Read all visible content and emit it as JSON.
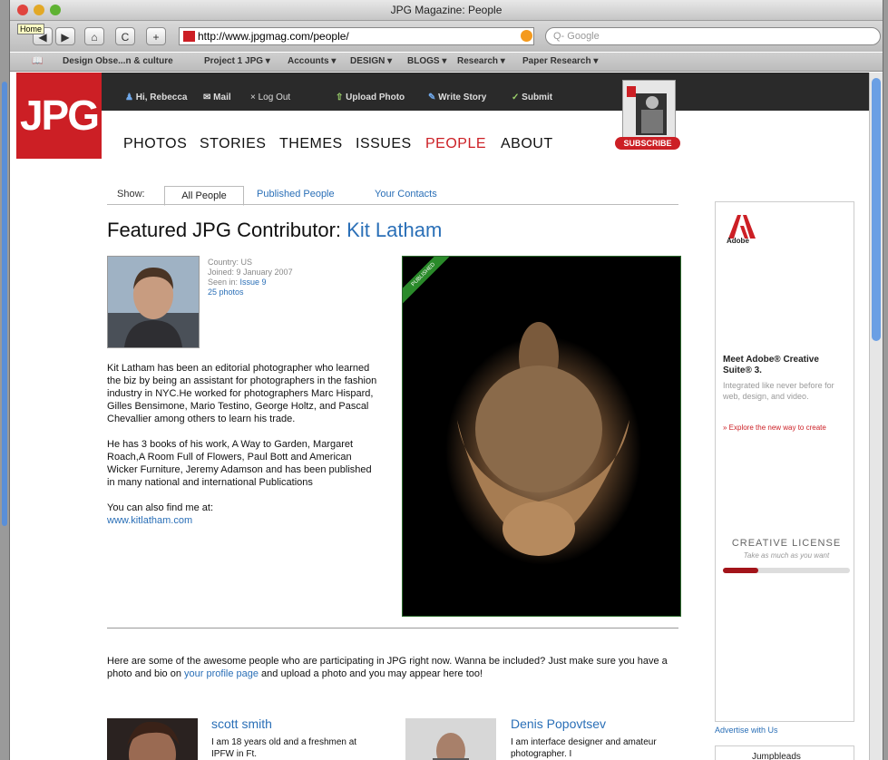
{
  "window": {
    "title": "JPG Magazine: People",
    "home_tooltip": "Home"
  },
  "toolbar": {
    "back": "◀",
    "forward": "▶",
    "home": "⌂",
    "reload": "C",
    "add": "+",
    "url": "http://www.jpgmag.com/people/",
    "search_placeholder": "Q- Google"
  },
  "bookmarks": [
    "Design Obse...n & culture",
    "Project 1 JPG ▾",
    "Accounts ▾",
    "DESIGN ▾",
    "BLOGS ▾",
    "Research ▾",
    "Paper Research ▾"
  ],
  "site": {
    "logo": "JPG",
    "user": {
      "greeting": "Hi, Rebecca",
      "mail": "Mail",
      "logout": "Log Out"
    },
    "actions": {
      "upload": "Upload Photo",
      "write": "Write Story",
      "submit": "Submit"
    },
    "nav": [
      "PHOTOS",
      "STORIES",
      "THEMES",
      "ISSUES",
      "PEOPLE",
      "ABOUT"
    ],
    "subscribe": "SUBSCRIBE",
    "accent": "#cc1f25"
  },
  "filter": {
    "show_label": "Show:",
    "tabs": [
      "All People",
      "Published People",
      "Your Contacts"
    ]
  },
  "featured": {
    "heading": "Featured JPG Contributor:",
    "name": "Kit Latham",
    "country": "Country: US",
    "joined": "Joined: 9 January 2007",
    "seen_in_label": "Seen in:",
    "seen_in_link": "Issue 9",
    "photos": "25 photos",
    "photo_ribbon": "PUBLISHED",
    "bio": [
      "Kit Latham has been an editorial photographer who learned the biz by being an assistant for photographers in the fashion industry in NYC.He worked for photographers Marc Hispard, Gilles Bensimone, Mario Testino, George Holtz, and Pascal Chevallier among others to learn his trade.",
      "He has 3 books of his work, A Way to Garden, Margaret Roach,A Room Full of Flowers, Paul Bott and American Wicker Furniture, Jeremy Adamson and has been published in many national and international Publications"
    ],
    "find_me": "You can also find me at:",
    "website": "www.kitlatham.com"
  },
  "intro": {
    "text_before": "Here are some of the awesome people who are participating in JPG right now. Wanna be included? Just make sure you have a photo and bio on",
    "link": "your profile page",
    "text_after": "and upload a photo and you may appear here too!"
  },
  "people": [
    {
      "name": "scott smith",
      "bio": "I am 18 years old and a freshmen at IPFW in Ft."
    },
    {
      "name": "Denis Popovtsev",
      "bio": "I am interface designer and amateur photographer. I"
    }
  ],
  "ad": {
    "brand": "Adobe",
    "headline": "Meet Adobe® Creative Suite® 3.",
    "sub": "Integrated like never before for web, design, and video.",
    "cta": "» Explore the new way to create",
    "cl_title": "CREATIVE LICENSE",
    "cl_sub": "Take as much as you want",
    "cl_level": 0.28,
    "advertise": "Advertise with Us",
    "ad2_text": "Jumpbleads"
  }
}
